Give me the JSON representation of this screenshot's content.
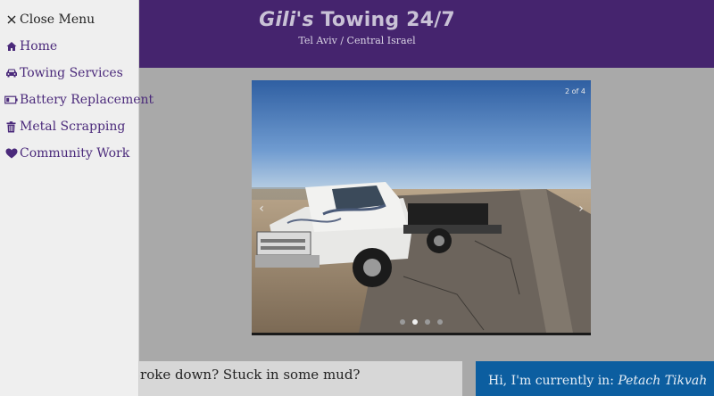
{
  "header": {
    "title_first": "Gili's",
    "title_rest": " Towing 24/7",
    "subtitle": "Tel Aviv / Central Israel"
  },
  "menu": {
    "close_label": "Close Menu",
    "items": [
      {
        "label": "Home",
        "icon": "home-icon"
      },
      {
        "label": "Towing Services",
        "icon": "car-icon"
      },
      {
        "label": "Battery Replacement",
        "icon": "battery-icon"
      },
      {
        "label": "Metal Scrapping",
        "icon": "trash-icon"
      },
      {
        "label": "Community Work",
        "icon": "heart-icon"
      }
    ]
  },
  "slider": {
    "counter": "2 of 4",
    "prev": "‹",
    "next": "›",
    "total": 4,
    "active_index": 1
  },
  "intro": {
    "text": "Broke down? Stuck in some mud?"
  },
  "location": {
    "prefix": "Hi, I'm currently in: ",
    "city": "Petach Tikvah"
  },
  "colors": {
    "header_bg": "#45246e",
    "menu_text": "#4b2a7b",
    "location_bg": "#0c5ea0"
  }
}
